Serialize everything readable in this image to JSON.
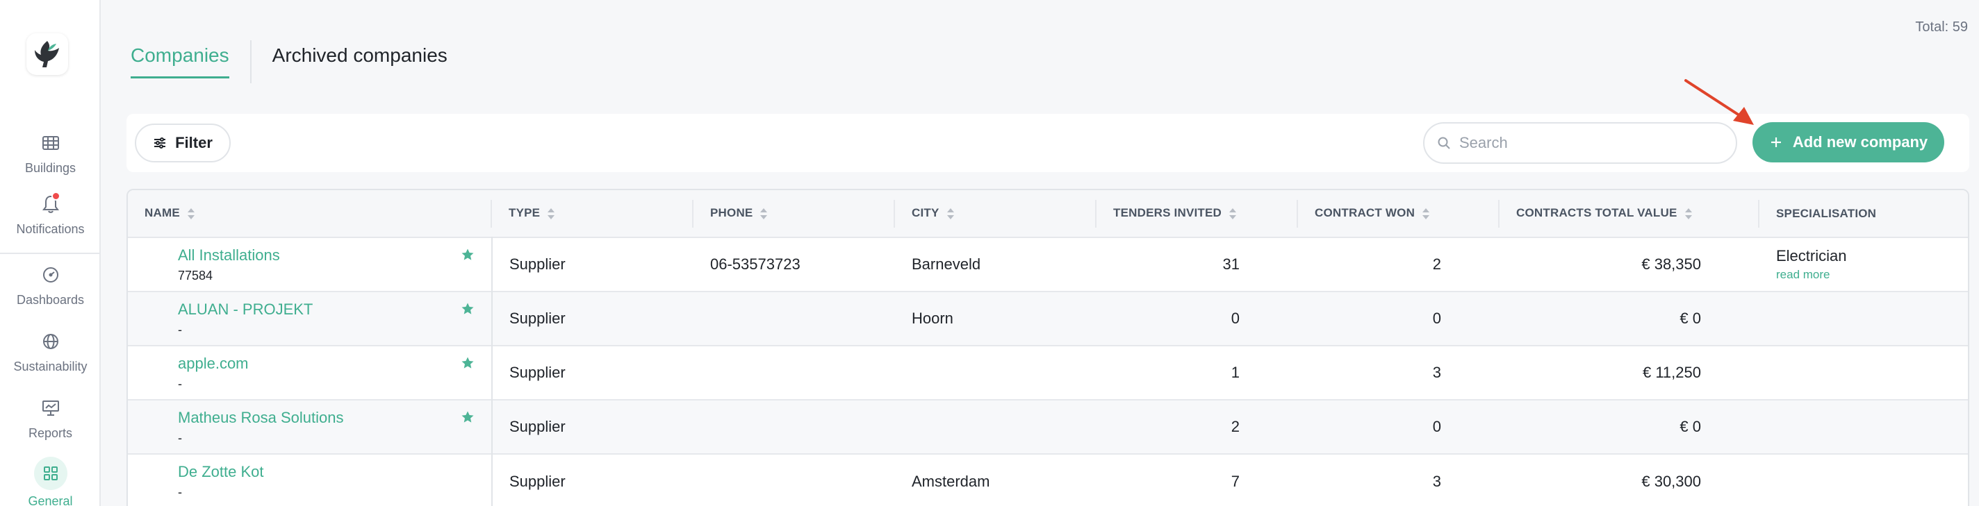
{
  "sidebar": {
    "logo_icon": "leaf-logo-icon",
    "items": [
      {
        "label": "Buildings",
        "icon": "building-icon"
      },
      {
        "label": "Notifications",
        "icon": "bell-icon"
      },
      {
        "label": "Dashboards",
        "icon": "gauge-icon"
      },
      {
        "label": "Sustainability",
        "icon": "globe-icon"
      },
      {
        "label": "Reports",
        "icon": "presentation-icon"
      },
      {
        "label": "General",
        "icon": "grid-icon",
        "active": true
      }
    ]
  },
  "header": {
    "total": "Total: 59",
    "tabs": [
      {
        "label": "Companies",
        "active": true
      },
      {
        "label": "Archived companies",
        "active": false
      }
    ]
  },
  "toolbar": {
    "filter_label": "Filter",
    "search_placeholder": "Search",
    "add_label": "Add new company"
  },
  "table": {
    "columns": [
      "NAME",
      "TYPE",
      "PHONE",
      "CITY",
      "TENDERS INVITED",
      "CONTRACT WON",
      "CONTRACTS TOTAL VALUE",
      "SPECIALISATION"
    ],
    "rows": [
      {
        "name": "All Installations",
        "sub": "77584",
        "starred": true,
        "type": "Supplier",
        "phone": "06-53573723",
        "city": "Barneveld",
        "tenders": "31",
        "won": "2",
        "value": "€ 38,350",
        "spec": "Electrician",
        "spec_link": "read more"
      },
      {
        "name": "ALUAN - PROJEKT",
        "sub": "-",
        "starred": true,
        "type": "Supplier",
        "phone": "",
        "city": "Hoorn",
        "tenders": "0",
        "won": "0",
        "value": "€ 0",
        "spec": "",
        "spec_link": ""
      },
      {
        "name": "apple.com",
        "sub": "-",
        "starred": true,
        "type": "Supplier",
        "phone": "",
        "city": "",
        "tenders": "1",
        "won": "3",
        "value": "€ 11,250",
        "spec": "",
        "spec_link": ""
      },
      {
        "name": "Matheus Rosa Solutions",
        "sub": "-",
        "starred": true,
        "type": "Supplier",
        "phone": "",
        "city": "",
        "tenders": "2",
        "won": "0",
        "value": "€ 0",
        "spec": "",
        "spec_link": ""
      },
      {
        "name": "De Zotte Kot",
        "sub": "-",
        "starred": false,
        "type": "Supplier",
        "phone": "",
        "city": "Amsterdam",
        "tenders": "7",
        "won": "3",
        "value": "€ 30,300",
        "spec": "",
        "spec_link": ""
      }
    ]
  },
  "colors": {
    "accent": "#4db496",
    "link": "#3fae8f",
    "notification_dot": "#ef4b4b",
    "annotation_arrow": "#e0442b"
  }
}
